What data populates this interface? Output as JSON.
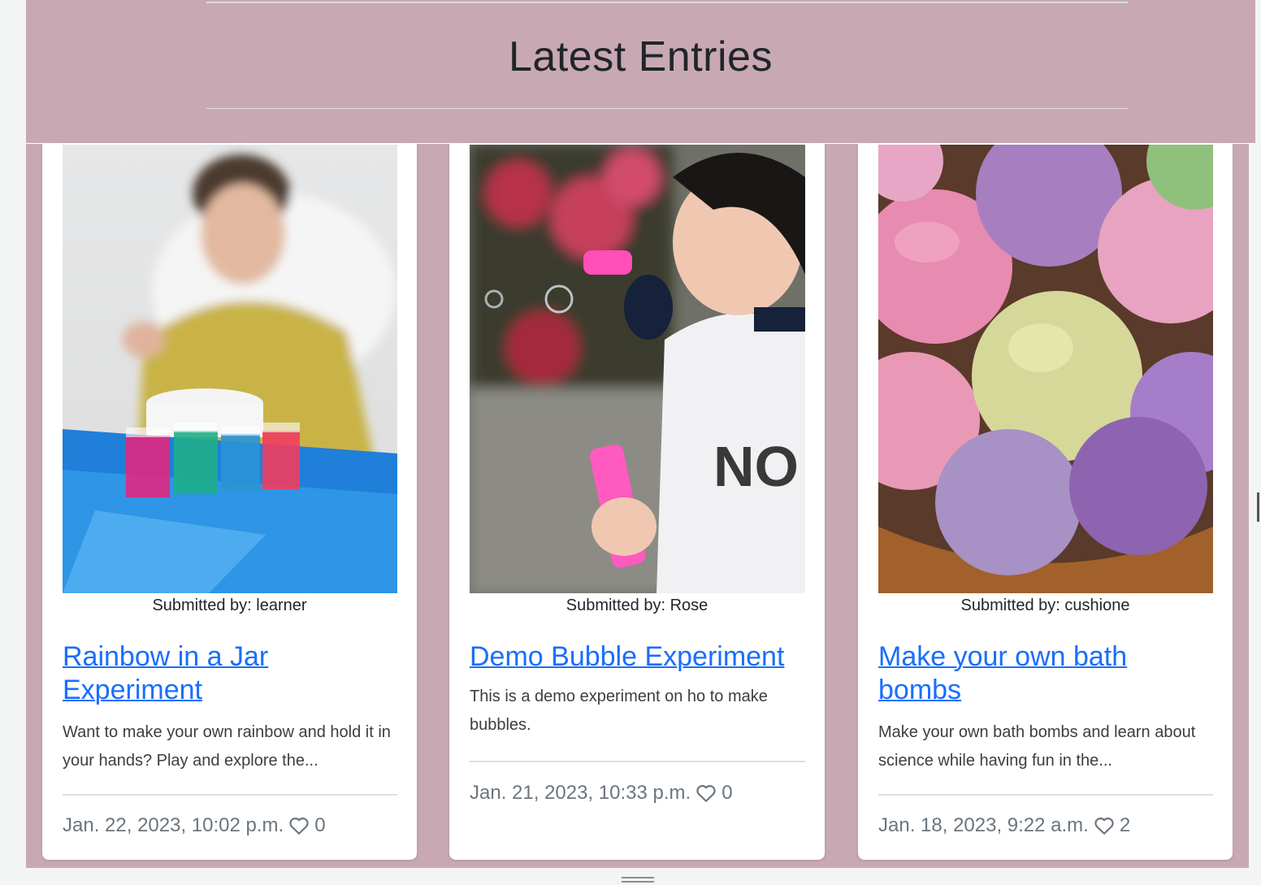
{
  "header": {
    "title": "Latest Entries"
  },
  "cards": [
    {
      "image_alt": "child with rainbow jars",
      "submitted_by": "Submitted by: learner",
      "title": "Rainbow in a Jar Experiment",
      "description": "Want to make your own rainbow and hold it in your hands? Play and explore the...",
      "date": "Jan. 22, 2023, 10:02 p.m.",
      "likes": "0"
    },
    {
      "image_alt": "girl blowing bubbles",
      "submitted_by": "Submitted by: Rose",
      "title": "Demo Bubble Experiment",
      "description": "This is a demo experiment on ho to make bubbles.",
      "date": "Jan. 21, 2023, 10:33 p.m.",
      "likes": "0"
    },
    {
      "image_alt": "colorful bath bombs",
      "submitted_by": "Submitted by: cushione",
      "title": "Make your own bath bombs",
      "description": "Make your own bath bombs and learn about science while having fun in the...",
      "date": "Jan. 18, 2023, 9:22 a.m.",
      "likes": "2"
    }
  ],
  "icons": {
    "like": "heart-icon",
    "resize": "drag-handle-icon"
  },
  "colors": {
    "frame": "#c8a9b3",
    "link": "#1a6efd",
    "card": "#ffffff"
  }
}
